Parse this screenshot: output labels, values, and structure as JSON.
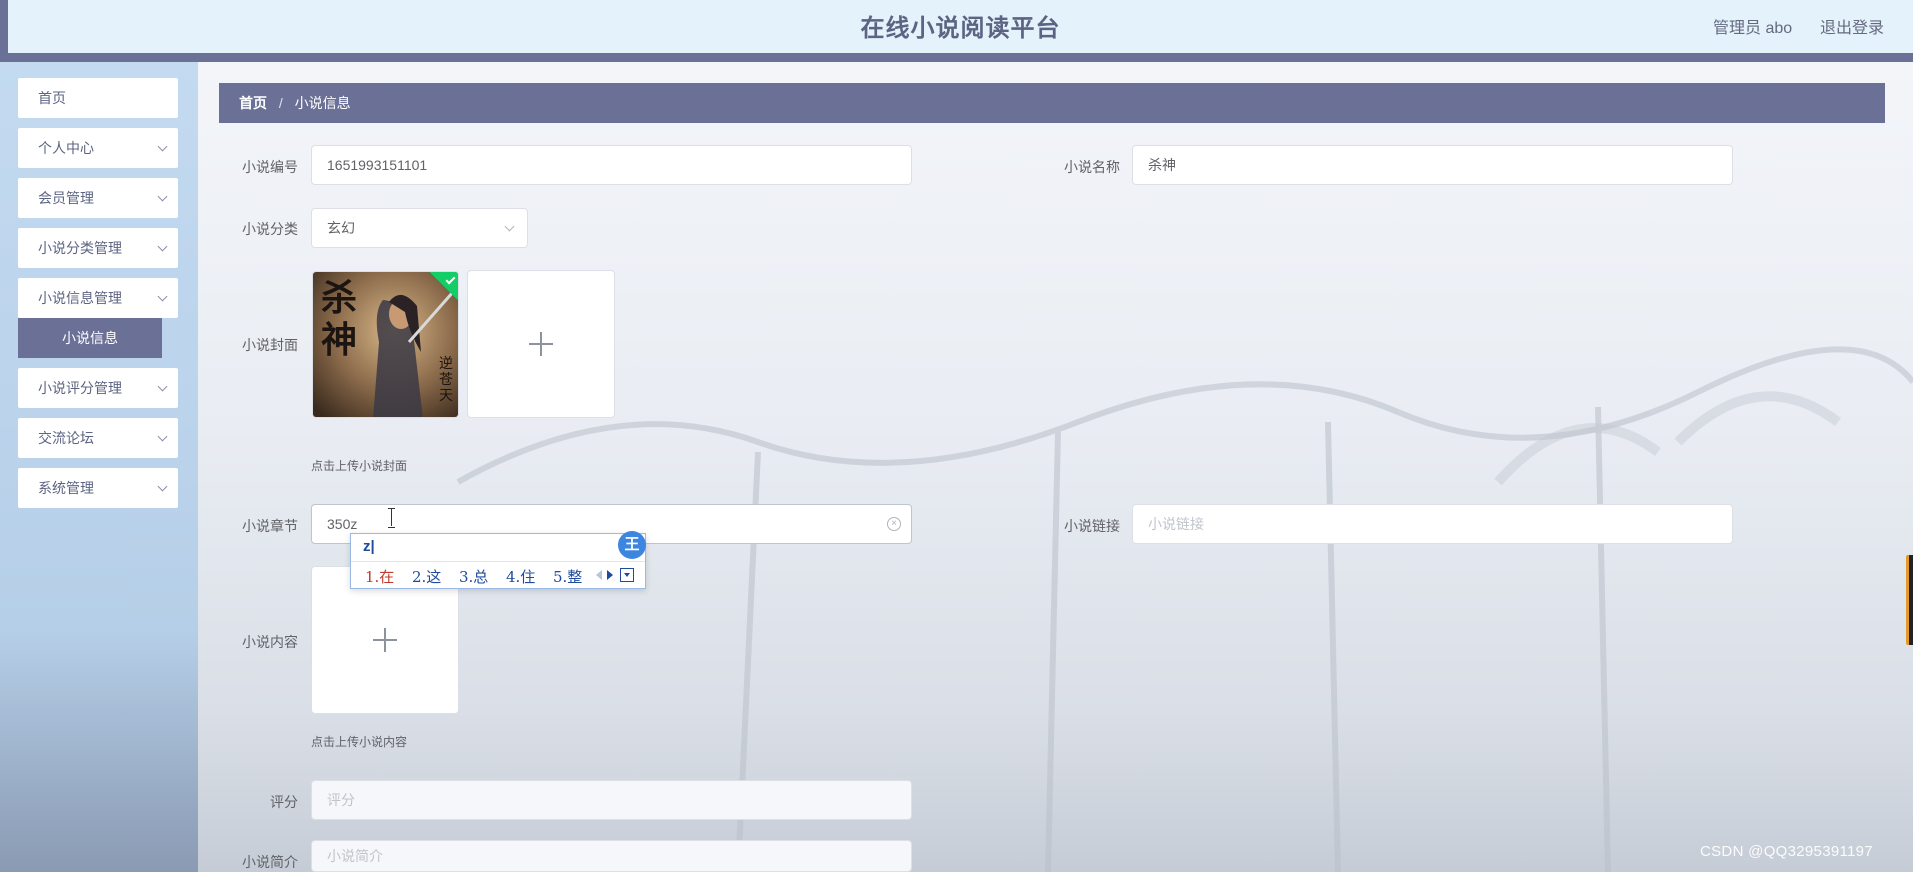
{
  "header": {
    "title": "在线小说阅读平台",
    "user": "管理员 abo",
    "logout": "退出登录"
  },
  "sidebar": {
    "items": [
      {
        "label": "首页"
      },
      {
        "label": "个人中心"
      },
      {
        "label": "会员管理"
      },
      {
        "label": "小说分类管理"
      },
      {
        "label": "小说信息管理"
      },
      {
        "label": "小说评分管理"
      },
      {
        "label": "交流论坛"
      },
      {
        "label": "系统管理"
      }
    ],
    "active_sub": "小说信息"
  },
  "breadcrumb": {
    "home": "首页",
    "separator": "/",
    "current": "小说信息"
  },
  "form": {
    "novel_id": {
      "label": "小说编号",
      "value": "1651993151101"
    },
    "novel_name": {
      "label": "小说名称",
      "value": "杀神"
    },
    "category": {
      "label": "小说分类",
      "value": "玄幻"
    },
    "cover": {
      "label": "小说封面",
      "hint": "点击上传小说封面"
    },
    "chapter": {
      "label": "小说章节",
      "value": "350z"
    },
    "link": {
      "label": "小说链接",
      "placeholder": "小说链接"
    },
    "content": {
      "label": "小说内容",
      "hint": "点击上传小说内容"
    },
    "score": {
      "label": "评分",
      "placeholder": "评分"
    },
    "intro": {
      "label": "小说简介",
      "placeholder": "小说简介"
    }
  },
  "cover_image": {
    "title_chars": [
      "杀",
      "神"
    ],
    "author": "逆苍天"
  },
  "ime": {
    "composition": "z|",
    "logo": "王",
    "candidates": [
      "1.在",
      "2.这",
      "3.总",
      "4.住",
      "5.整"
    ]
  },
  "watermark": "CSDN @QQ3295391197",
  "colors": {
    "accent": "#6b7096",
    "header_bg": "#e3f2fb",
    "success": "#13ce66"
  }
}
